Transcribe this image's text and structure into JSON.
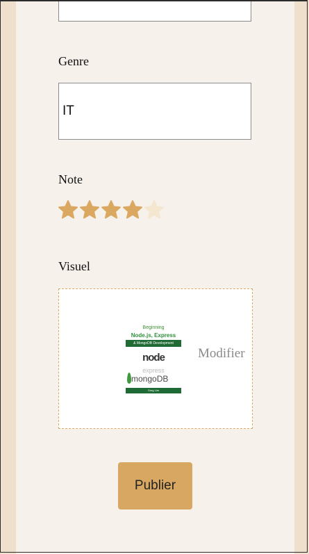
{
  "form": {
    "top_field_value": "",
    "genre_label": "Genre",
    "genre_value": "IT",
    "note_label": "Note",
    "rating": 4,
    "rating_max": 5,
    "visuel_label": "Visuel",
    "modify_label": "Modifier",
    "publish_label": "Publier"
  },
  "cover": {
    "line1": "Beginning",
    "line2": "Node.js, Express",
    "line3": "& MongoDB Development",
    "node_text": "node",
    "express_text": "express",
    "mongo_text": "mongoDB",
    "author": "Greg Lim"
  },
  "colors": {
    "star_filled": "#dba862",
    "star_empty": "#f5e6d0",
    "accent": "#d8a862"
  }
}
